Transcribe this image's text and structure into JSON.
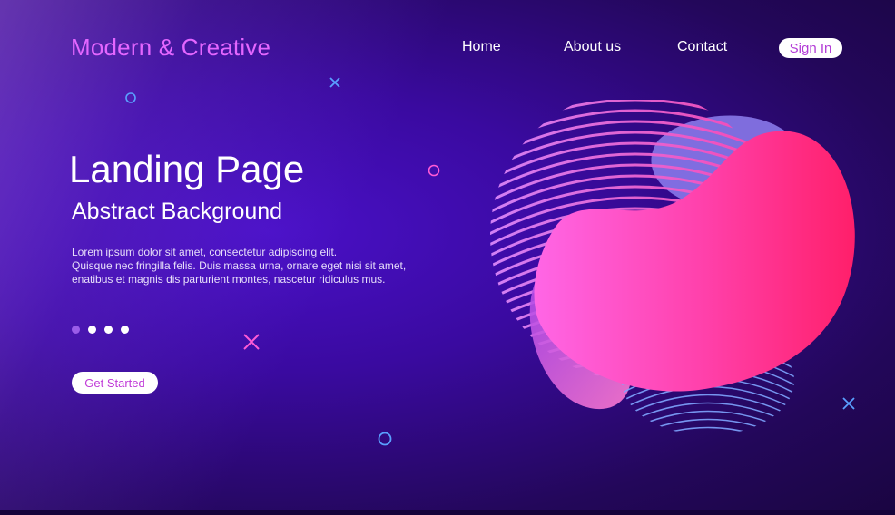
{
  "header": {
    "brand": "Modern & Creative",
    "nav": [
      "Home",
      "About us",
      "Contact"
    ],
    "sign_in": "Sign In"
  },
  "hero": {
    "title": "Landing Page",
    "subtitle": "Abstract Background",
    "body_lines": [
      "Lorem ipsum dolor sit amet, consectetur adipiscing elit.",
      "Quisque nec fringilla felis. Duis massa urna, ornare eget nisi sit amet,",
      "enatibus et magnis dis parturient montes, nascetur ridiculus mus."
    ],
    "cta": "Get Started",
    "slider_dots": 4,
    "active_dot": 1
  },
  "colors": {
    "brand": "#e466ff",
    "accent_pink": "#ff2f8a",
    "accent_magenta": "#ff5bd6",
    "background": "#3a0aa0",
    "deco_blue": "#5aa0ff",
    "deco_pink": "#ff5bd6"
  },
  "icons": [
    "x-mark-icon",
    "circle-outline-icon"
  ]
}
